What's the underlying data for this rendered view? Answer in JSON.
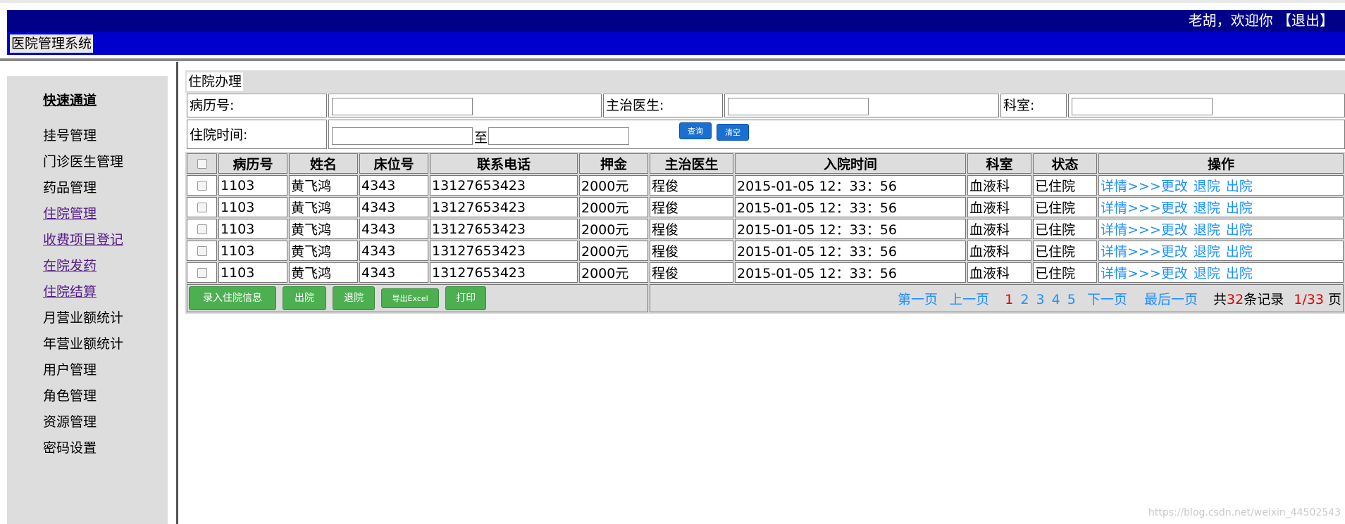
{
  "header": {
    "system_title": "医院管理系统",
    "welcome_text": "老胡，欢迎你",
    "logout_label": "【退出】"
  },
  "sidebar": {
    "quick_title": "快速通道",
    "items": [
      {
        "label": "挂号管理"
      },
      {
        "label": "门诊医生管理"
      },
      {
        "label": "药品管理"
      },
      {
        "label": "住院管理"
      },
      {
        "label": "收费项目登记"
      },
      {
        "label": "在院发药"
      },
      {
        "label": "住院结算"
      },
      {
        "label": "月营业额统计"
      },
      {
        "label": "年营业额统计"
      },
      {
        "label": "用户管理"
      },
      {
        "label": "角色管理"
      },
      {
        "label": "资源管理"
      },
      {
        "label": "密码设置"
      }
    ]
  },
  "main": {
    "title": "住院办理",
    "search": {
      "record_no_label": "病历号:",
      "doctor_label": "主治医生:",
      "department_label": "科室:",
      "admit_time_label": "住院时间:",
      "to_label": "至",
      "query_button": "查询",
      "clear_button": "清空"
    },
    "table": {
      "headers": [
        "病历号",
        "姓名",
        "床位号",
        "联系电话",
        "押金",
        "主治医生",
        "入院时间",
        "科室",
        "状态",
        "操作"
      ],
      "rows": [
        [
          "1103",
          "黄飞鸿",
          "4343",
          "13127653423",
          "2000元",
          "程俊",
          "2015-01-05 12：33：56",
          "血液科",
          "已住院"
        ],
        [
          "1103",
          "黄飞鸿",
          "4343",
          "13127653423",
          "2000元",
          "程俊",
          "2015-01-05 12：33：56",
          "血液科",
          "已住院"
        ],
        [
          "1103",
          "黄飞鸿",
          "4343",
          "13127653423",
          "2000元",
          "程俊",
          "2015-01-05 12：33：56",
          "血液科",
          "已住院"
        ],
        [
          "1103",
          "黄飞鸿",
          "4343",
          "13127653423",
          "2000元",
          "程俊",
          "2015-01-05 12：33：56",
          "血液科",
          "已住院"
        ],
        [
          "1103",
          "黄飞鸿",
          "4343",
          "13127653423",
          "2000元",
          "程俊",
          "2015-01-05 12：33：56",
          "血液科",
          "已住院"
        ]
      ],
      "ops": {
        "detail": "详情>>>",
        "edit": "更改",
        "return": "退院",
        "discharge": "出院"
      }
    },
    "actions": {
      "enter_info": "录入住院信息",
      "discharge": "出院",
      "return": "退院",
      "export_excel": "导出Excel",
      "print": "打印"
    },
    "pager": {
      "first": "第一页",
      "prev": "上一页",
      "pages": [
        "1",
        "2",
        "3",
        "4",
        "5"
      ],
      "next": "下一页",
      "last": "最后一页",
      "total_prefix": "共",
      "total_count": "32",
      "total_suffix": "条记录",
      "page_ratio": "1/33",
      "page_suffix": "页"
    }
  },
  "watermark": "https://blog.csdn.net/weixin_44502543",
  "colors": {
    "header_dark": "#000088",
    "header_blue": "#0000cc",
    "link": "#1e90ff",
    "green_button": "#4caf50"
  }
}
